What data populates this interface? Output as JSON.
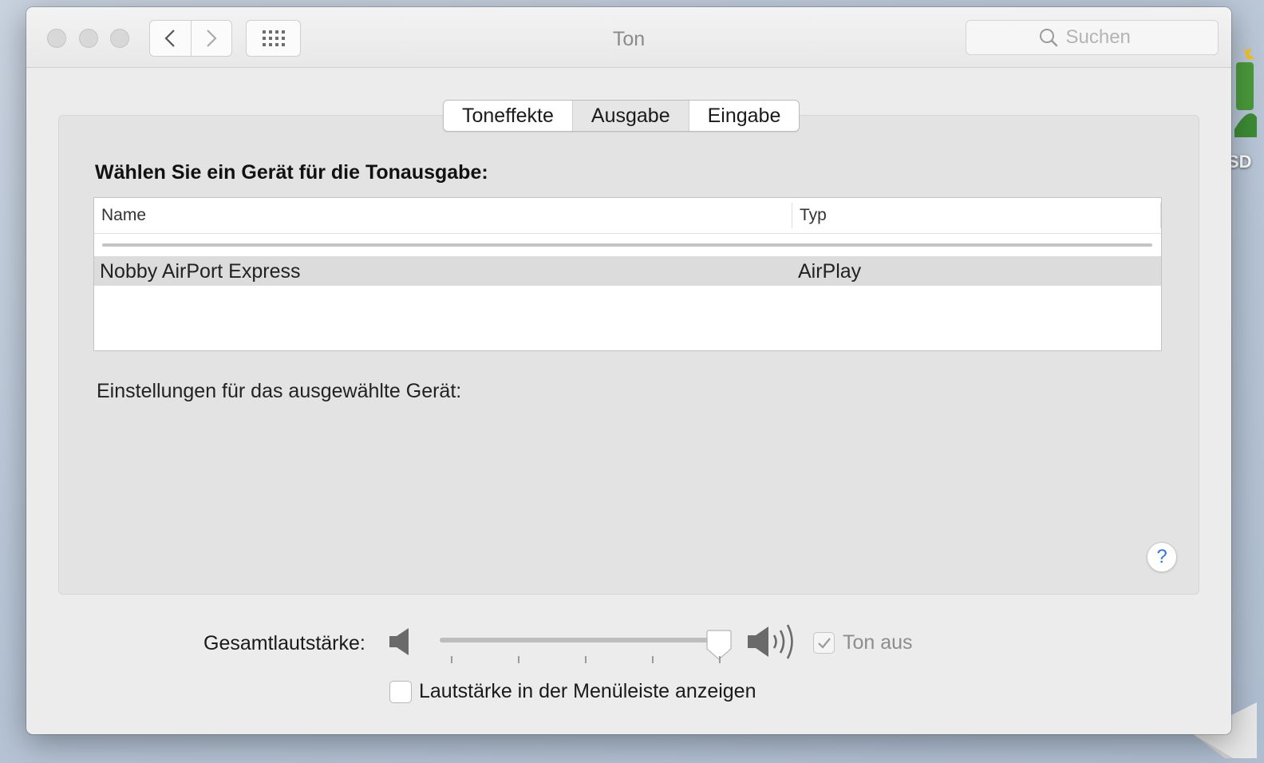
{
  "window": {
    "title": "Ton",
    "search_placeholder": "Suchen"
  },
  "tabs": [
    {
      "label": "Toneffekte",
      "active": false
    },
    {
      "label": "Ausgabe",
      "active": true
    },
    {
      "label": "Eingabe",
      "active": false
    }
  ],
  "output": {
    "heading": "Wählen Sie ein Gerät für die Tonausgabe:",
    "columns": {
      "name": "Name",
      "type": "Typ"
    },
    "devices": [
      {
        "name": "Nobby AirPort Express",
        "type": "AirPlay",
        "selected": true
      }
    ],
    "settings_label": "Einstellungen für das ausgewählte Gerät:"
  },
  "help": {
    "label": "?"
  },
  "volume": {
    "label": "Gesamtlautstärke:",
    "level": 1.0,
    "mute_label": "Ton aus",
    "mute_checked": true,
    "show_in_menubar_label": "Lautstärke in der Menüleiste anzeigen",
    "show_in_menubar_checked": false
  },
  "desktop": {
    "partial_label": "SD"
  },
  "colors": {
    "accent": "#3477d8"
  },
  "icons": [
    "back-chevron-icon",
    "forward-chevron-icon",
    "grid-icon",
    "search-icon",
    "speaker-low-icon",
    "speaker-high-icon",
    "checkmark-icon"
  ]
}
